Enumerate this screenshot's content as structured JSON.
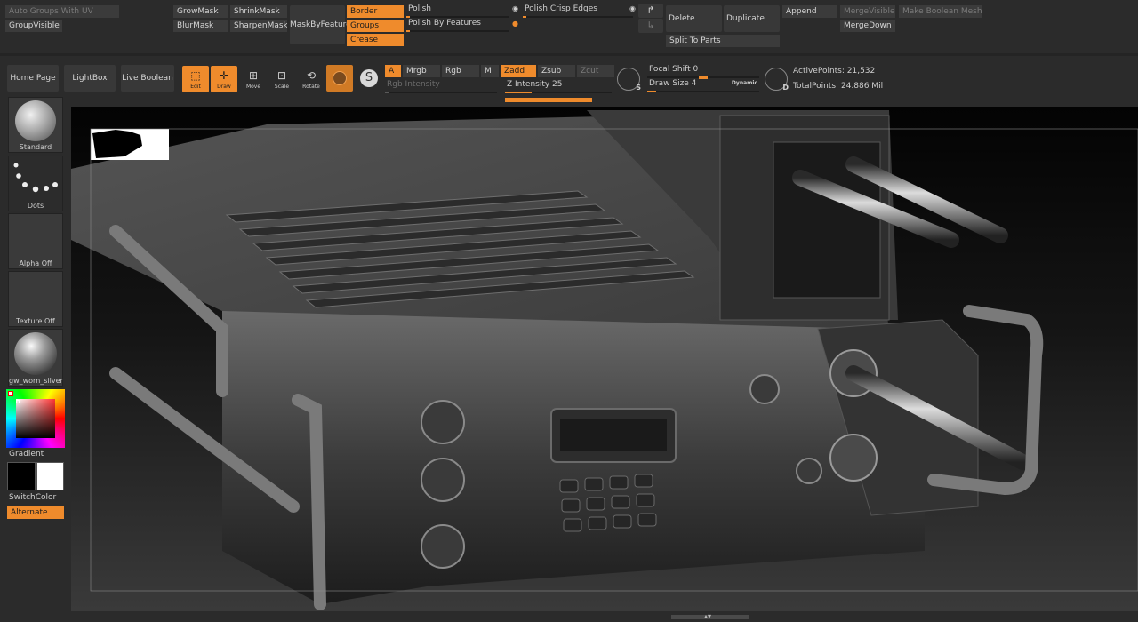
{
  "palette": {
    "accent": "#ef8b2c",
    "panel": "#3b3b3b",
    "background": "#2b2b2b",
    "viewport": "#1a1a1a"
  },
  "top_rows": {
    "auto_groups_uv": "Auto Groups With UV",
    "group_visible": "GroupVisible",
    "grow_mask": "GrowMask",
    "shrink_mask": "ShrinkMask",
    "blur_mask": "BlurMask",
    "sharpen_mask": "SharpenMask",
    "mask_by_feature": "MaskByFeature",
    "border": "Border",
    "groups": "Groups",
    "crease": "Crease",
    "polish": "Polish",
    "polish_by_features": "Polish By Features",
    "polish_crisp_edges": "Polish Crisp Edges",
    "delete": "Delete",
    "duplicate": "Duplicate",
    "split_to_parts": "Split To Parts",
    "append": "Append",
    "merge_visible": "MergeVisible",
    "merge_down": "MergeDown",
    "make_boolean_mesh": "Make Boolean Mesh"
  },
  "toolbar": {
    "home_page": "Home Page",
    "lightbox": "LightBox",
    "live_boolean": "Live Boolean",
    "edit": "Edit",
    "draw": "Draw",
    "move": "Move",
    "scale": "Scale",
    "rotate": "Rotate",
    "a": "A",
    "mrgb": "Mrgb",
    "rgb": "Rgb",
    "m": "M",
    "zadd": "Zadd",
    "zsub": "Zsub",
    "zcut": "Zcut",
    "rgb_intensity": "Rgb Intensity",
    "z_intensity": "Z Intensity 25",
    "z_intensity_level": 25,
    "s_label": "S",
    "focal_shift": "Focal Shift 0",
    "draw_size": "Draw Size 4",
    "dynamic": "Dynamic",
    "d_label": "D",
    "active_points": "ActivePoints: 21,532",
    "total_points": "TotalPoints: 24.886 Mil"
  },
  "left_panel": {
    "standard": "Standard",
    "dots": "Dots",
    "alpha_off": "Alpha Off",
    "texture_off": "Texture Off",
    "material": "gw_worn_silver",
    "gradient": "Gradient",
    "switch_color": "SwitchColor",
    "alternate": "Alternate"
  }
}
